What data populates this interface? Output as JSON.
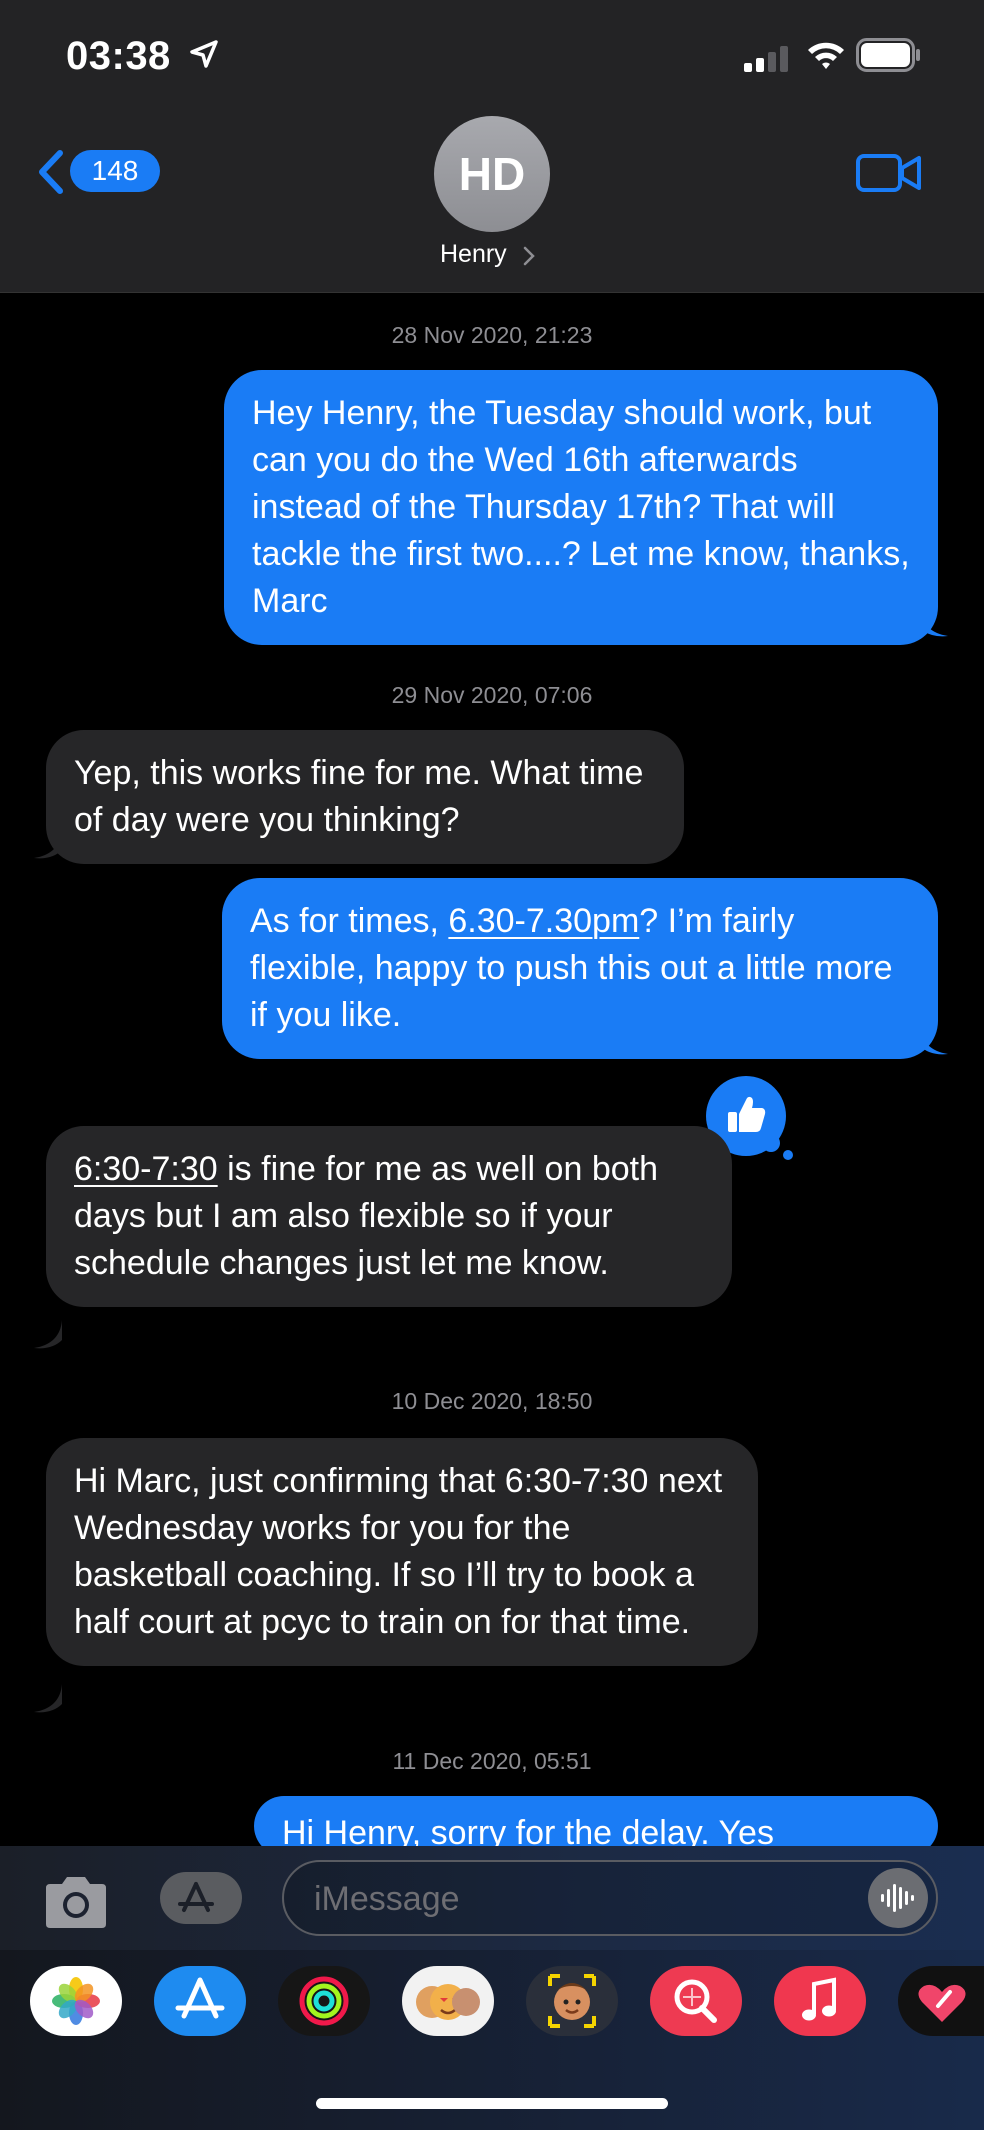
{
  "status_bar": {
    "time": "03:38"
  },
  "header": {
    "back_count": "148",
    "avatar_initials": "HD",
    "contact_name": "Henry"
  },
  "messages": [
    {
      "type": "timestamp",
      "text": "28 Nov 2020, 21:23"
    },
    {
      "type": "outgoing",
      "text": "Hey Henry, the Tuesday should work, but can you do the Wed 16th afterwards instead of the Thursday 17th? That will tackle the first two....? Let me know, thanks, Marc"
    },
    {
      "type": "timestamp",
      "text": "29 Nov 2020, 07:06"
    },
    {
      "type": "incoming",
      "text": "Yep, this works fine for me. What time of day were you thinking?"
    },
    {
      "type": "outgoing",
      "text_before": "As for times, ",
      "link": "6.30-7.30pm",
      "text_after": "? I’m fairly flexible, happy to push this out a little more if you like."
    },
    {
      "type": "incoming",
      "link": "6:30-7:30",
      "text_after": " is fine for me as well on both days but I am also flexible so if your schedule changes just let me know.",
      "tapback": "thumbs-up"
    },
    {
      "type": "timestamp",
      "text": "10 Dec 2020, 18:50"
    },
    {
      "type": "incoming",
      "text": "Hi Marc, just confirming that 6:30-7:30 next Wednesday works for you for the basketball coaching. If so I’ll try to book a half court at pcyc to train on for that time."
    },
    {
      "type": "timestamp",
      "text": "11 Dec 2020, 05:51"
    },
    {
      "type": "outgoing",
      "text": "Hi Henry, sorry for the delay. Yes"
    }
  ],
  "input": {
    "placeholder": "iMessage"
  },
  "app_drawer": [
    "Photos",
    "App Store",
    "Activity",
    "Memoji Stickers",
    "Memoji",
    "Search Images",
    "Music",
    "Digital Touch"
  ],
  "colors": {
    "outgoing_bubble": "#1a7cf5",
    "incoming_bubble": "#262628",
    "background": "#000000"
  }
}
